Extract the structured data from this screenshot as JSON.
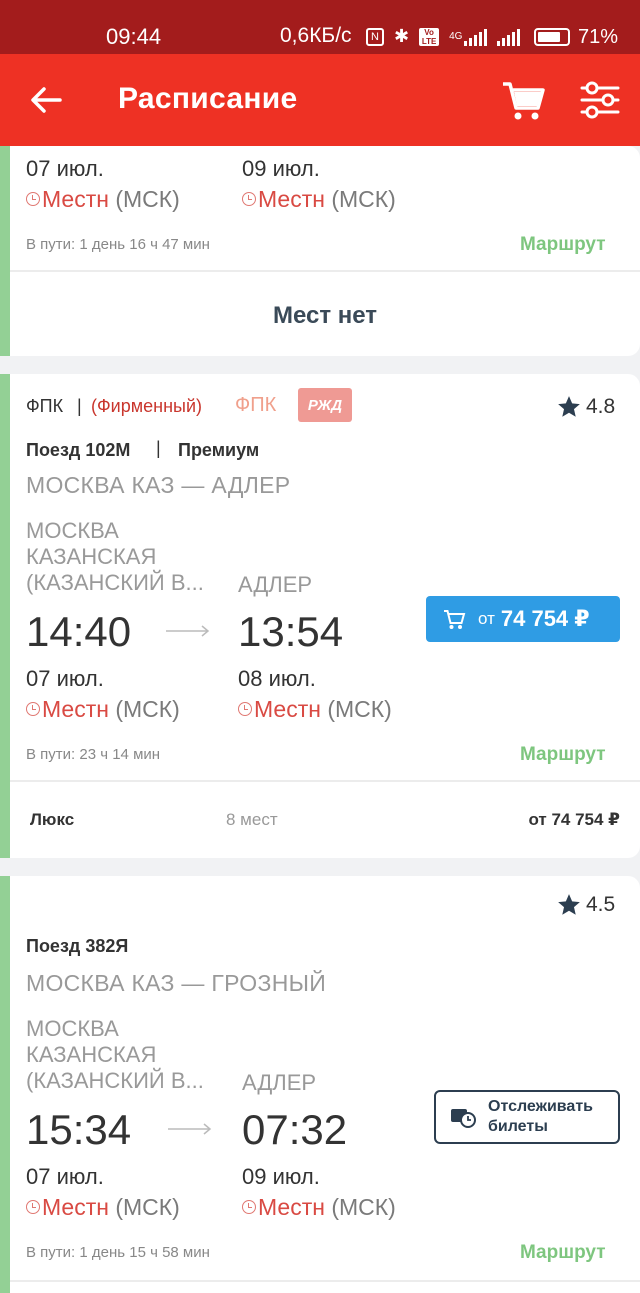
{
  "status_bar": {
    "time": "09:44",
    "net_speed": "0,6КБ/с",
    "network_type": "4G",
    "battery": "71%"
  },
  "app_bar": {
    "title": "Расписание",
    "back_icon": "arrow-left-icon",
    "cart_icon": "cart-icon",
    "filter_icon": "sliders-icon"
  },
  "cards": [
    {
      "dep_date": "07 июл.",
      "arr_date": "09 июл.",
      "local_label": "Местн",
      "msk_label": "(МСК)",
      "travel_time": "В пути: 1 день 16 ч 47 мин",
      "route_link": "Маршрут",
      "no_seats": "Мест нет"
    },
    {
      "carrier": "ФПК",
      "separator": "|",
      "brand": "(Фирменный)",
      "carrier_logo": "ФПК",
      "rzd_logo": "РЖД",
      "rating": "4.8",
      "train_no": "Поезд 102М",
      "train_sep": "|",
      "train_class": "Премиум",
      "route": "МОСКВА КАЗ — АДЛЕР",
      "dep_station": [
        "МОСКВА",
        "КАЗАНСКАЯ",
        "(КАЗАНСКИЙ В..."
      ],
      "arr_station": "АДЛЕР",
      "dep_time": "14:40",
      "arr_time": "13:54",
      "dep_date": "07 июл.",
      "arr_date": "08 июл.",
      "local_label": "Местн",
      "msk_label": "(МСК)",
      "price_from": "от",
      "price": "74 754 ₽",
      "travel_time": "В пути: 23 ч 14 мин",
      "route_link": "Маршрут",
      "seat_class": {
        "name": "Люкс",
        "seats": "8 мест",
        "price": "от 74 754 ₽"
      }
    },
    {
      "rating": "4.5",
      "train_no": "Поезд 382Я",
      "route": "МОСКВА КАЗ — ГРОЗНЫЙ",
      "dep_station": [
        "МОСКВА",
        "КАЗАНСКАЯ",
        "(КАЗАНСКИЙ В..."
      ],
      "arr_station": "АДЛЕР",
      "dep_time": "15:34",
      "arr_time": "07:32",
      "dep_date": "07 июл.",
      "arr_date": "09 июл.",
      "local_label": "Местн",
      "msk_label": "(МСК)",
      "track_button": "Отслеживать билеты",
      "travel_time": "В пути: 1 день 15 ч 58 мин",
      "route_link": "Маршрут"
    }
  ],
  "colors": {
    "status_bar": "#a31c1c",
    "app_bar": "#ee3124",
    "accent_green": "#93d095",
    "price_blue": "#2f9ce4",
    "local_red": "#d94a43"
  }
}
